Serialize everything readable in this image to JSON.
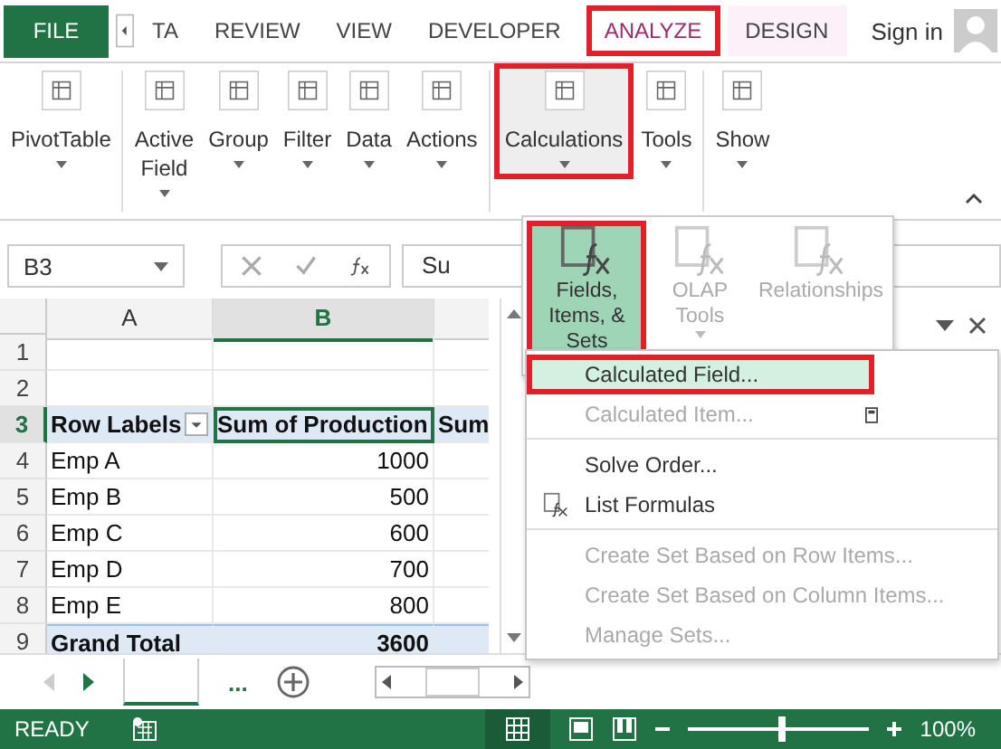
{
  "ribbon_tabs": [
    {
      "label": "FILE",
      "kind": "file",
      "selected": false,
      "highlighted": false
    },
    {
      "label": "TA",
      "kind": "tab",
      "selected": false,
      "highlighted": false
    },
    {
      "label": "REVIEW",
      "kind": "tab",
      "selected": false,
      "highlighted": false
    },
    {
      "label": "VIEW",
      "kind": "tab",
      "selected": false,
      "highlighted": false
    },
    {
      "label": "DEVELOPER",
      "kind": "tab",
      "selected": false,
      "highlighted": false
    },
    {
      "label": "ANALYZE",
      "kind": "context",
      "selected": true,
      "highlighted": true
    },
    {
      "label": "DESIGN",
      "kind": "context",
      "selected": false,
      "highlighted": false
    }
  ],
  "account": {
    "label": "Sign in"
  },
  "ribbon_buttons": [
    {
      "label": "PivotTable",
      "dropdown": true,
      "pressed": false,
      "highlighted": false
    },
    {
      "label": "Active Field",
      "dropdown": true,
      "pressed": false,
      "highlighted": false
    },
    {
      "label": "Group",
      "dropdown": true,
      "pressed": false,
      "highlighted": false
    },
    {
      "label": "Filter",
      "dropdown": true,
      "pressed": false,
      "highlighted": false
    },
    {
      "label": "Data",
      "dropdown": true,
      "pressed": false,
      "highlighted": false
    },
    {
      "label": "Actions",
      "dropdown": true,
      "pressed": false,
      "highlighted": false
    },
    {
      "label": "Calculations",
      "dropdown": true,
      "pressed": true,
      "highlighted": true
    },
    {
      "label": "Tools",
      "dropdown": true,
      "pressed": false,
      "highlighted": false
    },
    {
      "label": "Show",
      "dropdown": true,
      "pressed": false,
      "highlighted": false
    }
  ],
  "formula_bar": {
    "name_box": "B3",
    "formula": "Su"
  },
  "sheet": {
    "columns": [
      {
        "label": "A",
        "selected": false
      },
      {
        "label": "B",
        "selected": true
      }
    ],
    "rows": [
      {
        "number": "1",
        "selected": false,
        "kind": "blank",
        "cells": []
      },
      {
        "number": "2",
        "selected": false,
        "kind": "blank",
        "cells": []
      },
      {
        "number": "3",
        "selected": true,
        "kind": "header",
        "cells": [
          "Row Labels",
          "Sum of Production",
          "Sum"
        ]
      },
      {
        "number": "4",
        "selected": false,
        "kind": "data",
        "cells": [
          "Emp A",
          "1000"
        ]
      },
      {
        "number": "5",
        "selected": false,
        "kind": "data",
        "cells": [
          "Emp B",
          "500"
        ]
      },
      {
        "number": "6",
        "selected": false,
        "kind": "data",
        "cells": [
          "Emp C",
          "600"
        ]
      },
      {
        "number": "7",
        "selected": false,
        "kind": "data",
        "cells": [
          "Emp D",
          "700"
        ]
      },
      {
        "number": "8",
        "selected": false,
        "kind": "data",
        "cells": [
          "Emp E",
          "800"
        ]
      },
      {
        "number": "9",
        "selected": false,
        "kind": "total",
        "cells": [
          "Grand Total",
          "3600"
        ]
      }
    ]
  },
  "sheet_tabs": {
    "more": "..."
  },
  "gallery": [
    {
      "label": "Fields, Items, & Sets",
      "dropdown": true,
      "selected": true,
      "disabled": false,
      "highlighted": true
    },
    {
      "label": "OLAP Tools",
      "dropdown": true,
      "selected": false,
      "disabled": true,
      "highlighted": false
    },
    {
      "label": "Relationships",
      "dropdown": false,
      "selected": false,
      "disabled": true,
      "highlighted": false
    }
  ],
  "menu": [
    {
      "label": "Calculated Field...",
      "disabled": false,
      "selected": true,
      "highlighted": true,
      "icon": false,
      "side_icon": false,
      "separator_after": false
    },
    {
      "label": "Calculated Item...",
      "disabled": true,
      "selected": false,
      "highlighted": false,
      "icon": false,
      "side_icon": true,
      "separator_after": true
    },
    {
      "label": "Solve Order...",
      "disabled": false,
      "selected": false,
      "highlighted": false,
      "icon": false,
      "side_icon": false,
      "separator_after": false
    },
    {
      "label": "List Formulas",
      "disabled": false,
      "selected": false,
      "highlighted": false,
      "icon": true,
      "side_icon": false,
      "separator_after": true
    },
    {
      "label": "Create Set Based on Row Items...",
      "disabled": true,
      "selected": false,
      "highlighted": false,
      "icon": false,
      "side_icon": false,
      "separator_after": false
    },
    {
      "label": "Create Set Based on Column Items...",
      "disabled": true,
      "selected": false,
      "highlighted": false,
      "icon": false,
      "side_icon": false,
      "separator_after": false
    },
    {
      "label": "Manage Sets...",
      "disabled": true,
      "selected": false,
      "highlighted": false,
      "icon": false,
      "side_icon": false,
      "separator_after": false
    }
  ],
  "status_bar": {
    "status": "READY",
    "zoom": "100%",
    "zoom_slider": {
      "level": 0.52
    }
  }
}
